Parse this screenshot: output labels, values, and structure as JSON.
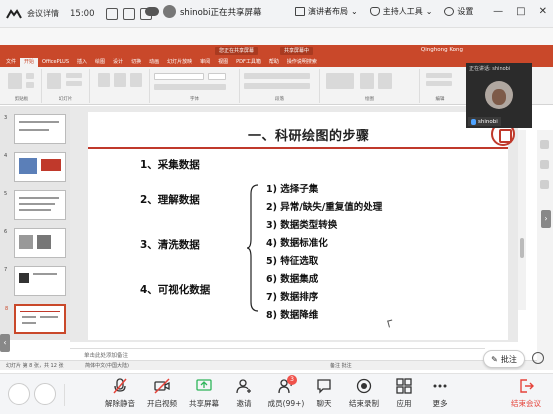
{
  "meeting": {
    "details_label": "会议详情",
    "time": "15:00",
    "sharer_status": "shinobi正在共享屏幕",
    "speaker_layout": "演讲者布局",
    "host_tools": "主持人工具",
    "settings": "设置",
    "win_minimize": "—",
    "win_maximize": "□",
    "win_close": "✕"
  },
  "ppt": {
    "title_pills": [
      "您正在共享屏幕",
      "共享屏幕中"
    ],
    "user": "Qinghong Kong",
    "tabs": [
      "文件",
      "开始",
      "OfficePLUS",
      "插入",
      "绘图",
      "设计",
      "切换",
      "动画",
      "幻灯片放映",
      "审阅",
      "视图",
      "PDF工具箱",
      "帮助",
      "操作说明搜索"
    ],
    "active_tab": "开始",
    "ribbon_groups": [
      "剪贴板",
      "幻灯片",
      "字体",
      "段落",
      "绘图",
      "编辑"
    ],
    "thumbnail_numbers": [
      "3",
      "4",
      "5",
      "6",
      "7",
      "8"
    ],
    "notes_placeholder": "单击此处添加备注",
    "status_left": "幻灯片 第 8 张，共 12 张",
    "status_lang": "简体中文(中国大陆)",
    "status_right": "备注  批注"
  },
  "slide": {
    "title": "一、科研绘图的步骤",
    "steps": [
      "1、采集数据",
      "2、理解数据",
      "3、清洗数据",
      "4、可视化数据"
    ],
    "substeps": [
      "1) 选择子集",
      "2) 异常/缺失/重复值的处理",
      "3) 数据类型转换",
      "4) 数据标准化",
      "5) 特征选取",
      "6) 数据集成",
      "7) 数据排序",
      "8) 数据降维"
    ]
  },
  "video": {
    "header": "正在讲话: shinobi",
    "name": "shinobi"
  },
  "annotate_label": "批注",
  "toolbar": {
    "mute": "解除静音",
    "video": "开启视频",
    "share": "共享屏幕",
    "invite": "邀请",
    "members": "成员(99+)",
    "members_badge": "3",
    "chat": "聊天",
    "record": "结束录制",
    "apps": "应用",
    "more": "更多",
    "end": "结束会议"
  },
  "colors": {
    "ppt_accent": "#c9482a",
    "share_green": "#3cc35a",
    "end_red": "#e5433a"
  }
}
